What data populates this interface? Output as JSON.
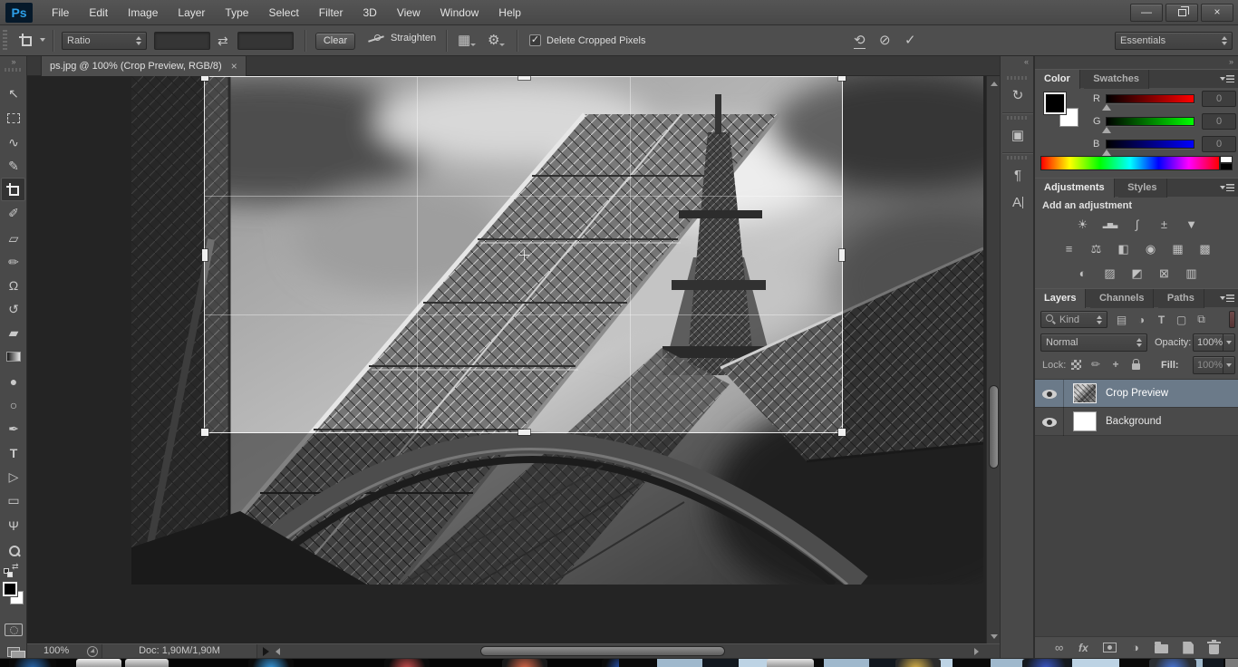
{
  "colors": {
    "logo_blue": "#2d9fe8",
    "selected_layer_bg": "#6b7a89",
    "channel_red": "#ff0000",
    "channel_green": "#00ff00",
    "channel_blue": "#0000ff",
    "filter_toggle_red": "#6e4a4a"
  },
  "titlebar": {
    "logo": "Ps",
    "menus": [
      "File",
      "Edit",
      "Image",
      "Layer",
      "Type",
      "Select",
      "Filter",
      "3D",
      "View",
      "Window",
      "Help"
    ],
    "minimize_glyph": "—",
    "close_glyph": "×"
  },
  "options_bar": {
    "ratio_label": "Ratio",
    "width_value": "",
    "height_value": "",
    "swap_glyph": "⇄",
    "clear_label": "Clear",
    "straighten_label": "Straighten",
    "grid_glyph": "▦",
    "gear_glyph": "⚙",
    "delete_cropped_label": "Delete Cropped Pixels",
    "checkbox_glyph": "✓",
    "reset_glyph": "⟲",
    "cancel_glyph": "⊘",
    "commit_glyph": "✓",
    "workspace": "Essentials"
  },
  "document_tab": {
    "title": "ps.jpg @ 100% (Crop Preview, RGB/8)",
    "close_glyph": "×"
  },
  "tool_strip": {
    "collapse_glyph": "»",
    "tools": [
      {
        "name": "move",
        "glyph": "↖"
      },
      {
        "name": "rectangular-marquee",
        "glyph": ""
      },
      {
        "name": "lasso",
        "glyph": "∿"
      },
      {
        "name": "quick-selection",
        "glyph": "✎"
      },
      {
        "name": "crop",
        "glyph": "",
        "active": true
      },
      {
        "name": "eyedropper",
        "glyph": "✐"
      },
      {
        "name": "spot-healing-brush",
        "glyph": "▱"
      },
      {
        "name": "brush",
        "glyph": "✏"
      },
      {
        "name": "clone-stamp",
        "glyph": "Ω"
      },
      {
        "name": "history-brush",
        "glyph": "↺"
      },
      {
        "name": "eraser",
        "glyph": "▰"
      },
      {
        "name": "gradient",
        "glyph": ""
      },
      {
        "name": "blur",
        "glyph": "●"
      },
      {
        "name": "dodge",
        "glyph": "○"
      },
      {
        "name": "pen",
        "glyph": "✒"
      },
      {
        "name": "type",
        "glyph": "T"
      },
      {
        "name": "path-selection",
        "glyph": "▷"
      },
      {
        "name": "rectangle",
        "glyph": "▭"
      },
      {
        "name": "hand",
        "glyph": "Ψ"
      },
      {
        "name": "zoom",
        "glyph": ""
      }
    ]
  },
  "dock": {
    "collapse_glyph": "«",
    "items": [
      {
        "name": "history",
        "glyph": "↻"
      },
      {
        "name": "properties",
        "glyph": "▣"
      },
      {
        "name": "paragraph",
        "glyph": "¶"
      },
      {
        "name": "character",
        "glyph": "A"
      }
    ]
  },
  "panels": {
    "expand_glyph": "»",
    "color": {
      "tab_color": "Color",
      "tab_swatches": "Swatches",
      "channels": [
        {
          "label": "R",
          "value": "0"
        },
        {
          "label": "G",
          "value": "0"
        },
        {
          "label": "B",
          "value": "0"
        }
      ]
    },
    "adjustments": {
      "tab_adjustments": "Adjustments",
      "tab_styles": "Styles",
      "heading": "Add an adjustment",
      "rows": [
        [
          {
            "name": "brightness-contrast",
            "glyph": "☀"
          },
          {
            "name": "levels",
            "glyph": "▂▅▃"
          },
          {
            "name": "curves",
            "glyph": "∫"
          },
          {
            "name": "exposure",
            "glyph": "±"
          },
          {
            "name": "vibrance",
            "glyph": "▼"
          }
        ],
        [
          {
            "name": "hue-saturation",
            "glyph": "≡"
          },
          {
            "name": "color-balance",
            "glyph": "⚖"
          },
          {
            "name": "black-and-white",
            "glyph": "◧"
          },
          {
            "name": "photo-filter",
            "glyph": "◉"
          },
          {
            "name": "channel-mixer",
            "glyph": "▦"
          },
          {
            "name": "color-lookup",
            "glyph": "▩"
          }
        ],
        [
          {
            "name": "invert",
            "glyph": "◐"
          },
          {
            "name": "posterize",
            "glyph": "▨"
          },
          {
            "name": "threshold",
            "glyph": "◩"
          },
          {
            "name": "selective-color",
            "glyph": "⊠"
          },
          {
            "name": "gradient-map",
            "glyph": "▥"
          }
        ]
      ]
    },
    "layers": {
      "tab_layers": "Layers",
      "tab_channels": "Channels",
      "tab_paths": "Paths",
      "kind_label": "Kind",
      "filter_icons": [
        {
          "name": "filter-pixel-layers",
          "glyph": "▤"
        },
        {
          "name": "filter-adjustment-layers",
          "glyph": "◑"
        },
        {
          "name": "filter-type-layers",
          "glyph": "T"
        },
        {
          "name": "filter-shape-layers",
          "glyph": "▢"
        },
        {
          "name": "filter-smart-objects",
          "glyph": "⧉"
        }
      ],
      "blend_mode": "Normal",
      "opacity_label": "Opacity:",
      "opacity_value": "100%",
      "lock_label": "Lock:",
      "lock_brush_glyph": "✏",
      "lock_move_glyph": "+",
      "fill_label": "Fill:",
      "fill_value": "100%",
      "layers": [
        {
          "name": "Crop Preview",
          "selected": true
        },
        {
          "name": "Background",
          "selected": false
        }
      ],
      "bottom": {
        "link_glyph": "∞",
        "fx_label": "fx",
        "adjustment_glyph": "◑"
      }
    }
  },
  "status_bar": {
    "zoom_value": "100%",
    "doc_info": "Doc: 1,90M/1,90M"
  },
  "icon_map": {
    "crop-icon": "css-shape",
    "rectangular-marquee-icon": "css-dashed-box",
    "gradient-icon": "css-gradient-box",
    "zoom-magnifier-icon": "css-shape",
    "search-icon": "css-shape",
    "eye-icon": "css-shape",
    "padlock-icon": "css-shape",
    "transparency-checker-icon": "css-shape",
    "layer-mask-icon": "css-shape",
    "folder-icon": "css-shape",
    "new-layer-icon": "css-shape",
    "trash-icon": "css-shape",
    "panel-menu-icon": "css-shape",
    "spin-arrows-icon": "css-shape",
    "straighten-icon": "css-shape",
    "restore-icon": "css-shape",
    "network-status-icon": "css-shape",
    "foreground-color-swatch": "black",
    "background-color-swatch": "white",
    "quick-mask-icon": "css-shape",
    "screen-mode-icon": "css-shape"
  }
}
